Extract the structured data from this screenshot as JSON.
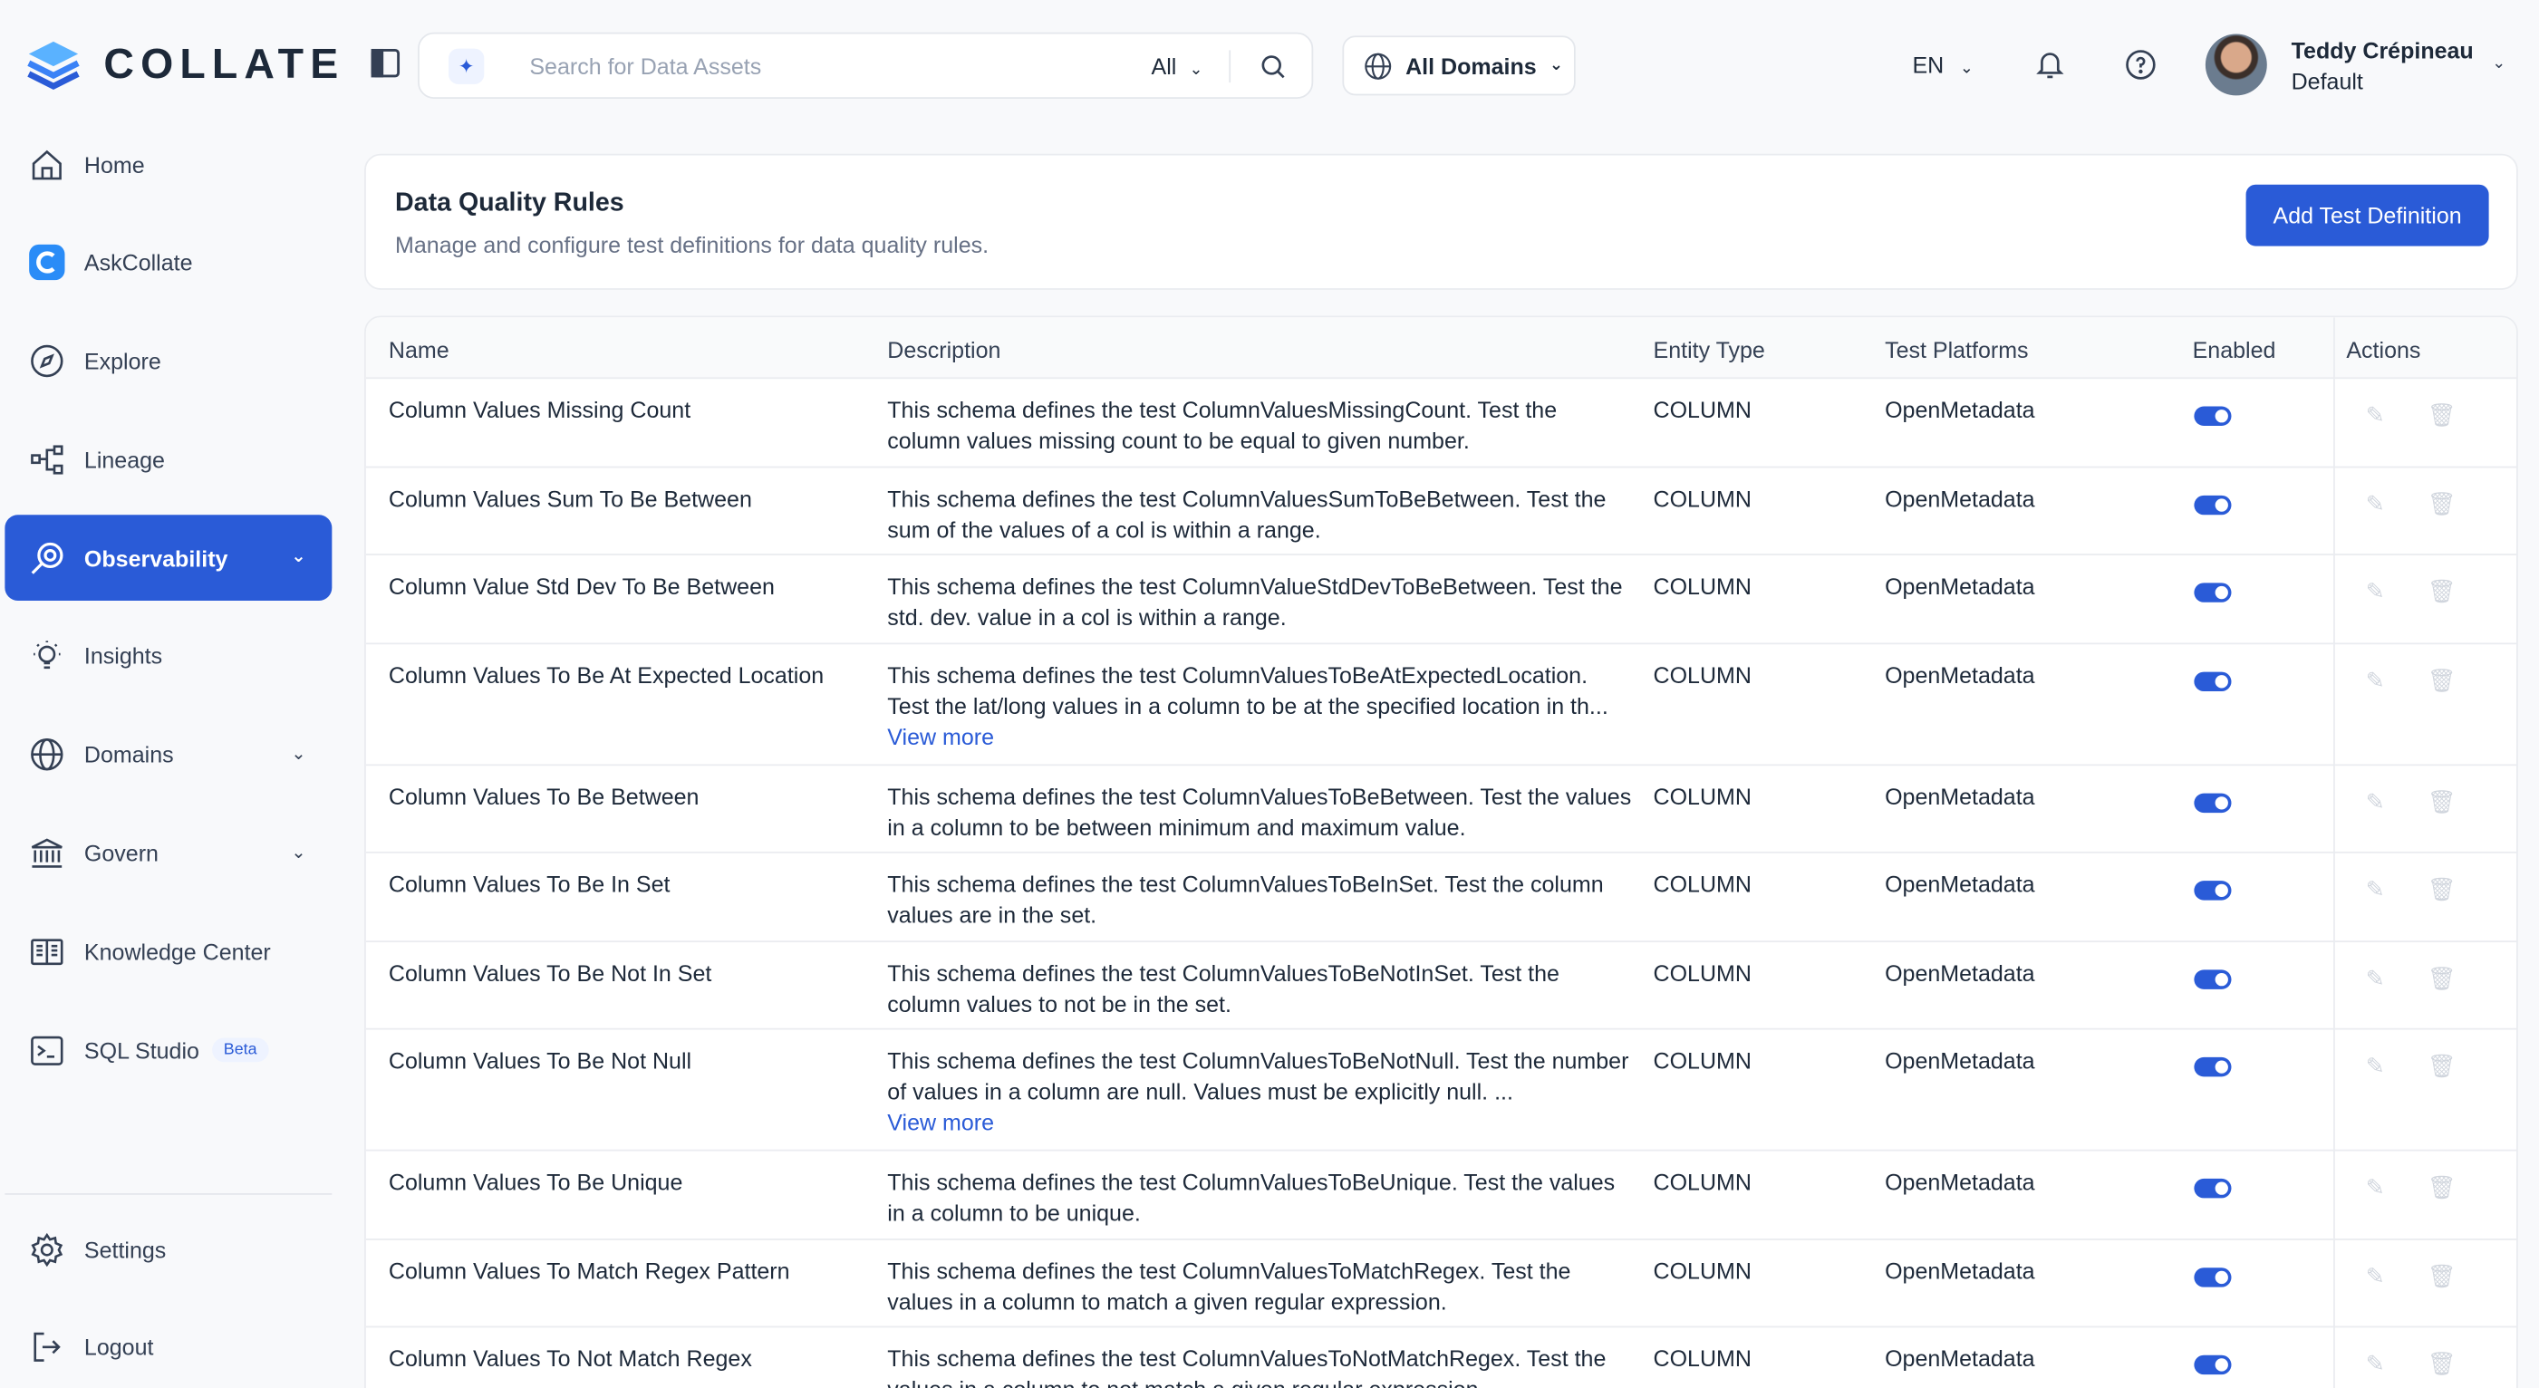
{
  "brand": {
    "name": "COLLATE"
  },
  "sidebar": {
    "items": [
      {
        "label": "Home",
        "icon": "home-icon"
      },
      {
        "label": "AskCollate",
        "icon": "askcollate-icon"
      },
      {
        "label": "Explore",
        "icon": "compass-icon"
      },
      {
        "label": "Lineage",
        "icon": "lineage-icon"
      },
      {
        "label": "Observability",
        "icon": "observability-icon",
        "active": true
      },
      {
        "label": "Insights",
        "icon": "lightbulb-icon"
      },
      {
        "label": "Domains",
        "icon": "globe-icon"
      },
      {
        "label": "Govern",
        "icon": "bank-icon"
      },
      {
        "label": "Knowledge Center",
        "icon": "book-icon"
      },
      {
        "label": "SQL Studio",
        "icon": "terminal-icon",
        "badge": "Beta"
      }
    ],
    "bottom": [
      {
        "label": "Settings",
        "icon": "gear-icon"
      },
      {
        "label": "Logout",
        "icon": "logout-icon"
      }
    ]
  },
  "topbar": {
    "search_placeholder": "Search for Data Assets",
    "search_scope": "All",
    "domains_label": "All Domains",
    "language": "EN",
    "user_name": "Teddy Crépineau",
    "user_role": "Default"
  },
  "page": {
    "title": "Data Quality Rules",
    "subtitle": "Manage and configure test definitions for data quality rules.",
    "add_button": "Add Test Definition"
  },
  "table": {
    "headers": {
      "name": "Name",
      "description": "Description",
      "entity_type": "Entity Type",
      "platforms": "Test Platforms",
      "enabled": "Enabled",
      "actions": "Actions"
    },
    "view_more": "View more",
    "rows": [
      {
        "name": "Column Values Missing Count",
        "description": "This schema defines the test ColumnValuesMissingCount. Test the column values missing count to be equal to given number.",
        "entity": "COLUMN",
        "platform": "OpenMetadata",
        "enabled": true
      },
      {
        "name": "Column Values Sum To Be Between",
        "description": "This schema defines the test ColumnValuesSumToBeBetween. Test the sum of the values of a col is within a range.",
        "entity": "COLUMN",
        "platform": "OpenMetadata",
        "enabled": true
      },
      {
        "name": "Column Value Std Dev To Be Between",
        "description": "This schema defines the test ColumnValueStdDevToBeBetween. Test the std. dev. value in a col is within a range.",
        "entity": "COLUMN",
        "platform": "OpenMetadata",
        "enabled": true
      },
      {
        "name": "Column Values To Be At Expected Location",
        "description": "This schema defines the test ColumnValuesToBeAtExpectedLocation. Test the lat/long values in a column to be at the specified location in th...",
        "entity": "COLUMN",
        "platform": "OpenMetadata",
        "enabled": true,
        "more": true
      },
      {
        "name": "Column Values To Be Between",
        "description": "This schema defines the test ColumnValuesToBeBetween. Test the values in a column to be between minimum and maximum value.",
        "entity": "COLUMN",
        "platform": "OpenMetadata",
        "enabled": true
      },
      {
        "name": "Column Values To Be In Set",
        "description": "This schema defines the test ColumnValuesToBeInSet. Test the column values are in the set.",
        "entity": "COLUMN",
        "platform": "OpenMetadata",
        "enabled": true
      },
      {
        "name": "Column Values To Be Not In Set",
        "description": "This schema defines the test ColumnValuesToBeNotInSet. Test the column values to not be in the set.",
        "entity": "COLUMN",
        "platform": "OpenMetadata",
        "enabled": true
      },
      {
        "name": "Column Values To Be Not Null",
        "description": "This schema defines the test ColumnValuesToBeNotNull. Test the number of values in a column are null. Values must be explicitly null. ...",
        "entity": "COLUMN",
        "platform": "OpenMetadata",
        "enabled": true,
        "more": true
      },
      {
        "name": "Column Values To Be Unique",
        "description": "This schema defines the test ColumnValuesToBeUnique. Test the values in a column to be unique.",
        "entity": "COLUMN",
        "platform": "OpenMetadata",
        "enabled": true
      },
      {
        "name": "Column Values To Match Regex Pattern",
        "description": "This schema defines the test ColumnValuesToMatchRegex. Test the values in a column to match a given regular expression.",
        "entity": "COLUMN",
        "platform": "OpenMetadata",
        "enabled": true
      },
      {
        "name": "Column Values To Not Match Regex",
        "description": "This schema defines the test ColumnValuesToNotMatchRegex. Test the values in a column to not match a given regular expression.",
        "entity": "COLUMN",
        "platform": "OpenMetadata",
        "enabled": true
      }
    ]
  },
  "colors": {
    "accent": "#2a5bd7",
    "text": "#1d2939",
    "muted": "#667085"
  }
}
